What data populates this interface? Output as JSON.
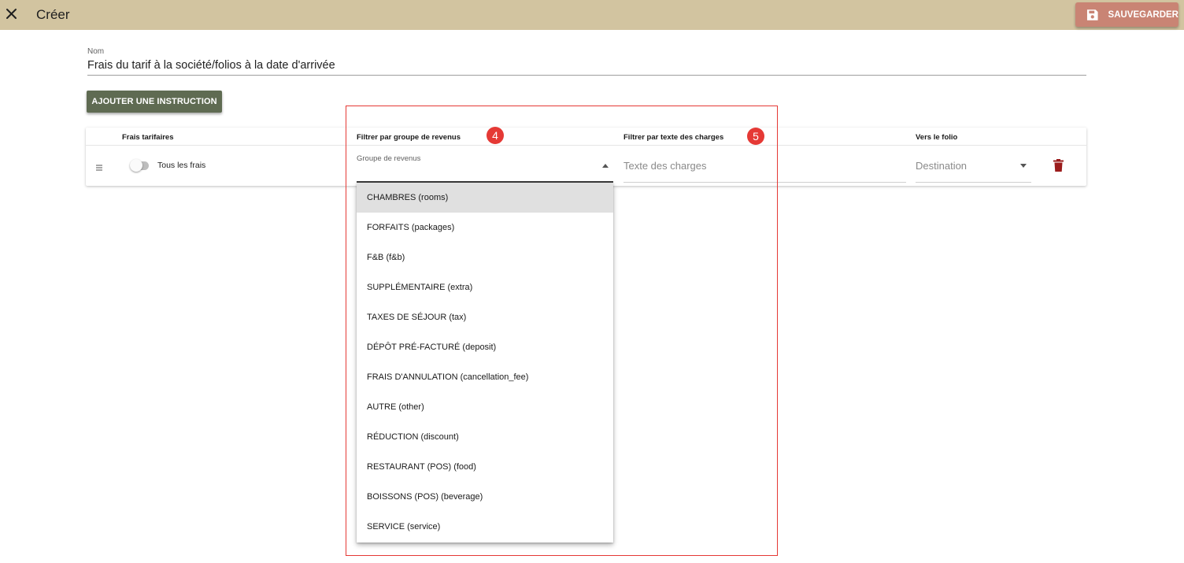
{
  "header": {
    "close_icon": "close-icon",
    "title": "Créer",
    "save_label": "SAUVEGARDER",
    "save_icon": "floppy-disk-icon",
    "bar_color": "#d2c4a0",
    "save_color": "#c98474"
  },
  "form": {
    "name_label": "Nom",
    "name_value": "Frais du tarif à la société/folios à la date d'arrivée",
    "add_instruction_label": "AJOUTER UNE INSTRUCTION",
    "add_button_color": "#5f6b52"
  },
  "table": {
    "headers": {
      "charges": "Frais tarifaires",
      "revenue_group": "Filtrer par groupe de revenus",
      "charge_text": "Filtrer par texte des charges",
      "folio": "Vers le folio"
    },
    "row": {
      "drag_icon": "drag-handle-icon",
      "charges_value": "Tous les frais",
      "revenue_group_label": "Groupe de revenus",
      "charge_text_placeholder": "Texte des charges",
      "destination_placeholder": "Destination",
      "delete_icon": "trash-icon",
      "delete_color": "#9b1c1c"
    }
  },
  "dropdown": {
    "options": [
      "CHAMBRES (rooms)",
      "FORFAITS (packages)",
      "F&B (f&b)",
      "SUPPLÉMENTAIRE (extra)",
      "TAXES DE SÉJOUR (tax)",
      "DÉPÔT PRÉ-FACTURÉ (deposit)",
      "FRAIS D'ANNULATION (cancellation_fee)",
      "AUTRE (other)",
      "RÉDUCTION (discount)",
      "RESTAURANT (POS) (food)",
      "BOISSONS (POS) (beverage)",
      "SERVICE (service)"
    ],
    "highlighted_index": 0
  },
  "annotations": {
    "badges": [
      "4",
      "5"
    ],
    "color": "#e53935"
  }
}
